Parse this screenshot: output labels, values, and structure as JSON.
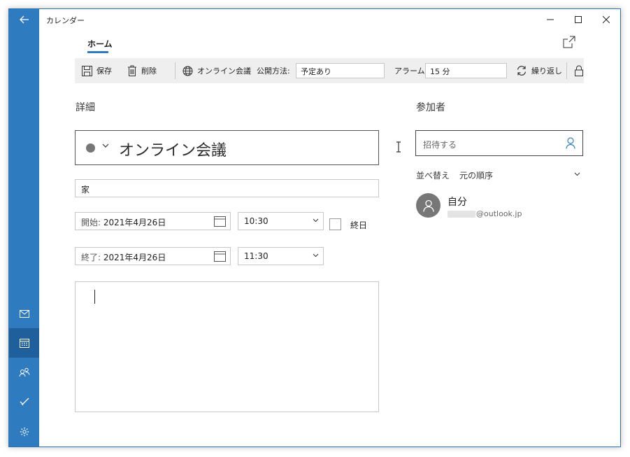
{
  "window": {
    "title": "カレンダー"
  },
  "ribbon": {
    "tab_home": "ホーム"
  },
  "toolbar": {
    "save": "保存",
    "delete": "削除",
    "online_meeting": "オンライン会議",
    "visibility_label": "公開方法:",
    "visibility_value": "予定あり",
    "alarm_label": "アラーム:",
    "alarm_value": "15 分",
    "repeat": "繰り返し"
  },
  "details": {
    "heading": "詳細",
    "event_title": "オンライン会議",
    "location": "家",
    "start_label": "開始:",
    "start_date": "2021年4月26日",
    "start_time": "10:30",
    "end_label": "終了:",
    "end_date": "2021年4月26日",
    "end_time": "11:30",
    "all_day": "終日"
  },
  "attendees": {
    "heading": "参加者",
    "invite_placeholder": "招待する",
    "sort_label": "並べ替え",
    "sort_value": "元の順序",
    "list": [
      {
        "name": "自分",
        "email": "@outlook.jp"
      }
    ]
  },
  "colors": {
    "accent": "#2f7bc0",
    "rail_active": "#1f5f9c",
    "toolbar_bg": "#efefef"
  }
}
